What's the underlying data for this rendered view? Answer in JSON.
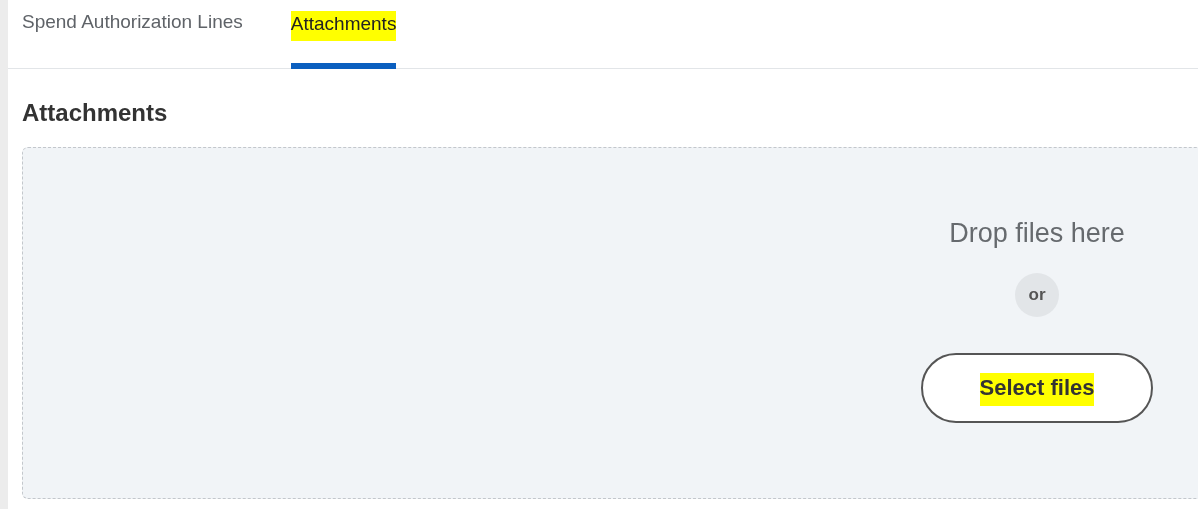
{
  "tabs": [
    {
      "label": "Spend Authorization Lines",
      "selected": false,
      "highlighted": false
    },
    {
      "label": "Attachments",
      "selected": true,
      "highlighted": true
    }
  ],
  "section": {
    "title": "Attachments"
  },
  "dropzone": {
    "prompt": "Drop files here",
    "separator": "or",
    "button": {
      "label": "Select files",
      "highlighted": true
    }
  }
}
